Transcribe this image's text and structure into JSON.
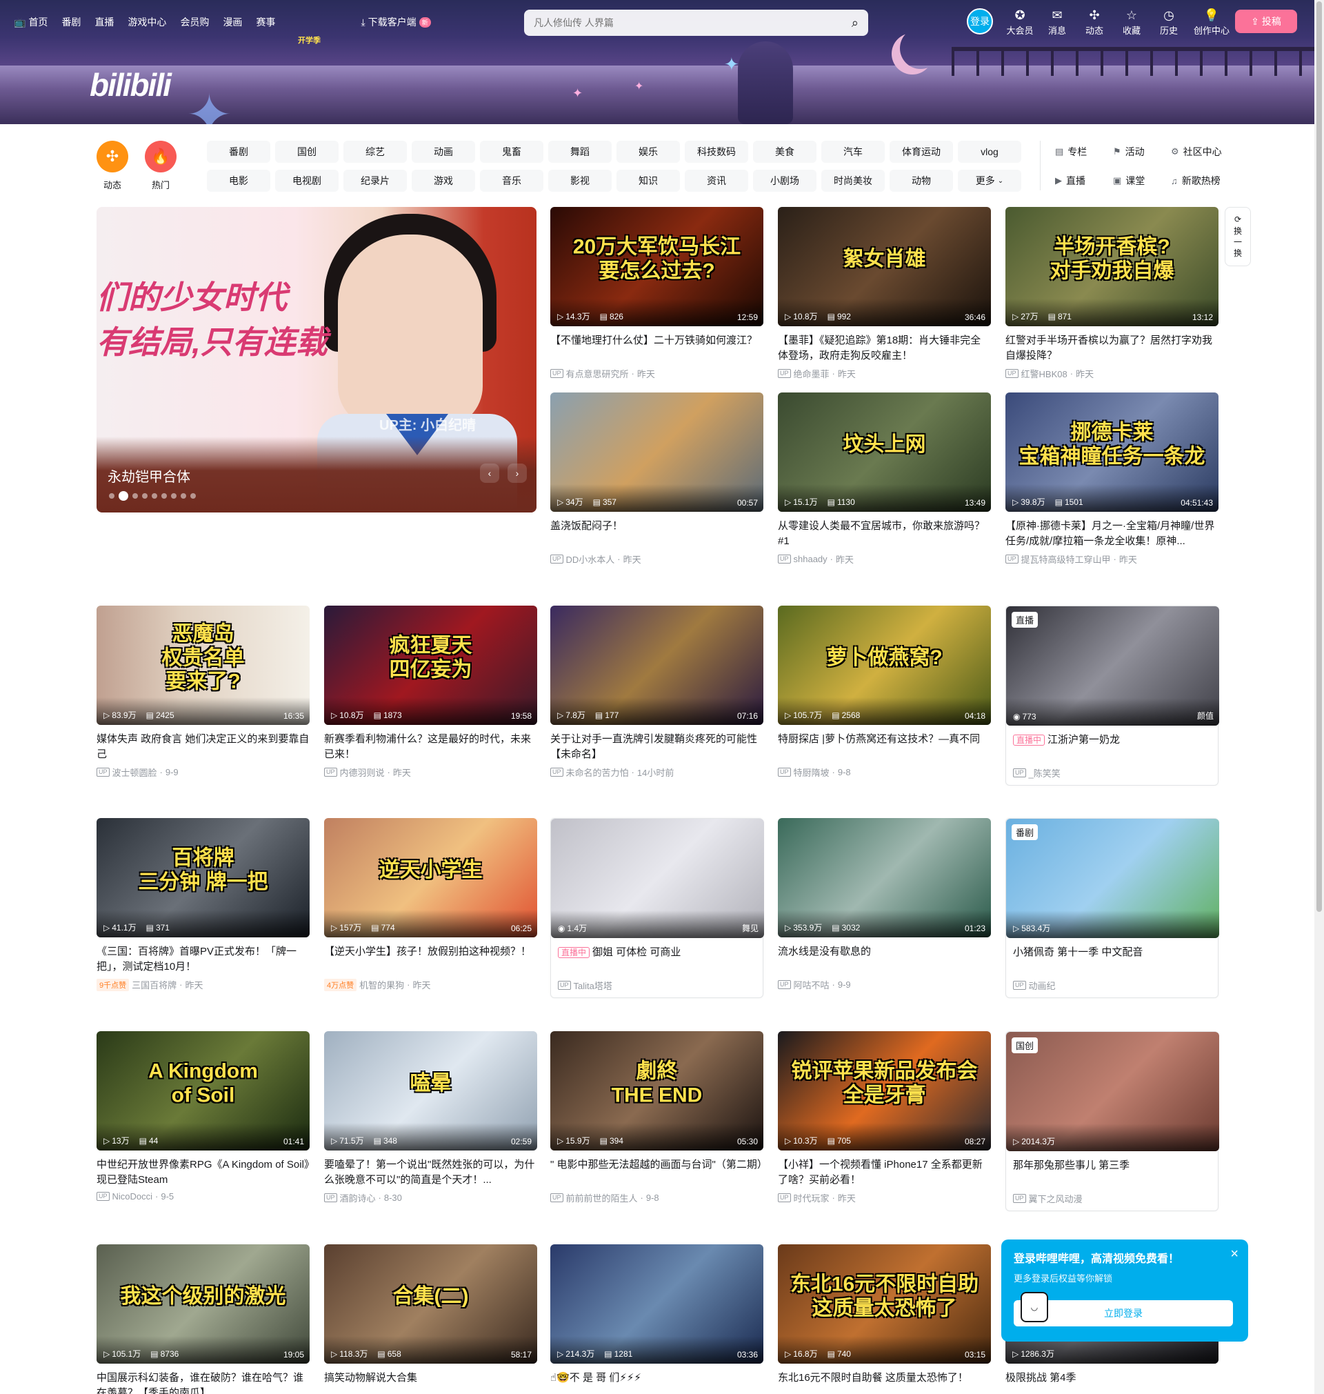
{
  "nav": {
    "left": [
      {
        "icon": "tv-icon",
        "label": "首页"
      },
      {
        "label": "番剧"
      },
      {
        "label": "直播"
      },
      {
        "label": "游戏中心"
      },
      {
        "label": "会员购"
      },
      {
        "label": "漫画"
      },
      {
        "label": "赛事"
      }
    ],
    "download": {
      "label": "下载客户端",
      "badge": "新"
    },
    "search": {
      "placeholder": "凡人修仙传 人界篇"
    },
    "login_avatar": "登录",
    "right": [
      {
        "icon": "vip-icon",
        "label": "大会员"
      },
      {
        "icon": "message-icon",
        "label": "消息"
      },
      {
        "icon": "dynamic-icon",
        "label": "动态"
      },
      {
        "icon": "favorite-icon",
        "label": "收藏"
      },
      {
        "icon": "history-icon",
        "label": "历史"
      },
      {
        "icon": "creator-icon",
        "label": "创作中心"
      }
    ],
    "upload": "投稿"
  },
  "banner": {
    "logo": "bilibili",
    "tag": "开学季"
  },
  "quick": {
    "dynamic": "动态",
    "hot": "热门"
  },
  "channels": [
    "番剧",
    "国创",
    "综艺",
    "动画",
    "鬼畜",
    "舞蹈",
    "娱乐",
    "科技数码",
    "美食",
    "汽车",
    "体育运动",
    "vlog",
    "电影",
    "电视剧",
    "纪录片",
    "游戏",
    "音乐",
    "影视",
    "知识",
    "资讯",
    "小剧场",
    "时尚美妆",
    "动物",
    "更多"
  ],
  "side_links": [
    {
      "icon": "column-icon",
      "label": "专栏"
    },
    {
      "icon": "activity-icon",
      "label": "活动"
    },
    {
      "icon": "community-icon",
      "label": "社区中心"
    },
    {
      "icon": "live-icon",
      "label": "直播"
    },
    {
      "icon": "course-icon",
      "label": "课堂"
    },
    {
      "icon": "music-icon",
      "label": "新歌热榜"
    }
  ],
  "carousel": {
    "title": "永劫铠甲合体",
    "overlay_line1": "们的少女时代",
    "overlay_line2": "有结局,只有连载",
    "up_mark": "UP主: 小白纪晴",
    "dot_count": 9,
    "active_dot": 1
  },
  "refresh": [
    "换",
    "一",
    "换"
  ],
  "cards": [
    {
      "art": "20万大军饮马长江\n要怎么过去?",
      "plays": "14.3万",
      "danmaku": "826",
      "duration": "12:59",
      "title": "【不懂地理打什么仗】二十万铁骑如何渡江？",
      "up": "有点意思研究所",
      "date": "昨天",
      "bg": "linear-gradient(135deg,#2a0a05,#8a2a10 50%,#1a0802)"
    },
    {
      "art": "絮女肖雄",
      "plays": "10.8万",
      "danmaku": "992",
      "duration": "36:46",
      "title": "【墨菲】《疑犯追踪》第18期：肖大锤非完全体登场，政府走狗反咬雇主！",
      "up": "绝命墨菲",
      "date": "昨天",
      "bg": "linear-gradient(135deg,#2a2018,#6a4a30 50%,#1a120c)"
    },
    {
      "art": "半场开香槟?\n对手劝我自爆",
      "plays": "27万",
      "danmaku": "871",
      "duration": "13:12",
      "title": "红警对手半场开香槟以为赢了？居然打字劝我自爆投降？",
      "up": "红警HBK08",
      "date": "昨天",
      "bg": "linear-gradient(135deg,#4a5a30,#8a8a50 50%,#3a4a28)"
    },
    {
      "art": "",
      "plays": "34万",
      "danmaku": "357",
      "duration": "00:57",
      "title": "盖浇饭配闷子！",
      "up": "DD小水本人",
      "date": "昨天",
      "bg": "linear-gradient(135deg,#8aa0b0,#d0a060 50%,#5a6a78)"
    },
    {
      "art": "坟头上网",
      "plays": "15.1万",
      "danmaku": "1130",
      "duration": "13:49",
      "title": "从零建设人类最不宜居城市，你敢来旅游吗？ #1",
      "up": "shhaady",
      "date": "昨天",
      "bg": "linear-gradient(135deg,#3a4a30,#6a7a50 50%,#2a3a22)"
    },
    {
      "art": "挪德卡莱\n宝箱神瞳任务一条龙",
      "plays": "39.8万",
      "danmaku": "1501",
      "duration": "04:51:43",
      "title": "【原神·挪德卡莱】月之一·全宝箱/月神瞳/世界任务/成就/摩拉箱一条龙全收集！原神...",
      "up": "提瓦特高级特工穿山甲",
      "date": "昨天",
      "bg": "linear-gradient(135deg,#3a4a7a,#7a8ab0 50%,#2a3a60)"
    },
    {
      "art": "恶魔岛\n权贵名单\n要来了?",
      "plays": "83.9万",
      "danmaku": "2425",
      "duration": "16:35",
      "title": "媒体失声 政府食言 她们决定正义的来到要靠自己",
      "up": "波士顿圆脸",
      "date": "9-9",
      "bg": "linear-gradient(90deg,#c0a090,#e0d0c0 40%,#f4f0e8)"
    },
    {
      "art": "疯狂夏天\n四亿妄为",
      "plays": "10.8万",
      "danmaku": "1873",
      "duration": "19:58",
      "title": "新赛季看利物浦什么？这是最好的时代，未来已来！",
      "up": "内德羽则说",
      "date": "昨天",
      "bg": "linear-gradient(135deg,#2a1a3a,#a01820 50%,#3a1a2a)"
    },
    {
      "art": "",
      "plays": "7.8万",
      "danmaku": "177",
      "duration": "07:16",
      "title": "关于让对手一直洗牌引发腱鞘炎疼死的可能性【未命名】",
      "up": "未命名的苦力怕",
      "date": "14小时前",
      "bg": "linear-gradient(135deg,#3a2a60,#a07a40 50%,#2a1a40)"
    },
    {
      "art": "萝卜做燕窝?",
      "plays": "105.7万",
      "danmaku": "2568",
      "duration": "04:18",
      "title": "特厨探店 |萝卜仿燕窝还有这技术？—真不同",
      "up": "特厨隋坡",
      "date": "9-8",
      "bg": "linear-gradient(135deg,#5a6a20,#d0b040 50%,#4a5a18)"
    },
    {
      "live": true,
      "tag": "直播",
      "viewers": "773",
      "corner": "颜值",
      "title": "江浙沪第一奶龙",
      "up": "_陈笑笑",
      "bg": "linear-gradient(135deg,#303038,#90909a 50%,#404048)"
    },
    {
      "art": "百将牌\n三分钟 牌一把",
      "plays": "41.1万",
      "danmaku": "371",
      "duration": "",
      "title": "《三国：百将牌》首曝PV正式发布！「牌一把」，测试定档10月！",
      "hot": "9千点赞",
      "up": "三国百将牌",
      "date": "昨天",
      "bg": "linear-gradient(135deg,#2a3038,#6a7078 50%,#1a2028)"
    },
    {
      "art": "逆天小学生",
      "plays": "157万",
      "danmaku": "774",
      "duration": "06:25",
      "title": "【逆天小学生】孩子！放假别拍这种视频？！",
      "hot": "4万点赞",
      "up": "机智的果狗",
      "date": "昨天",
      "bg": "linear-gradient(135deg,#c08060,#f0c080 50%,#e05030)"
    },
    {
      "live": true,
      "tag": "",
      "viewers": "1.4万",
      "corner": "舞见",
      "title": "御姐 可体检 可商业",
      "up": "Talita塔塔",
      "bg": "linear-gradient(135deg,#c0c0c8,#e8e8ee 50%,#b0b0b8)"
    },
    {
      "art": "",
      "plays": "353.9万",
      "danmaku": "3032",
      "duration": "01:23",
      "title": "流水线是没有歇息的",
      "up": "阿咕不咕",
      "date": "9-9",
      "bg": "linear-gradient(135deg,#3a6a5a,#a0b8b0 50%,#2a5a4a)"
    },
    {
      "bangumi": true,
      "tag": "番剧",
      "plays": "583.4万",
      "title": "小猪佩奇 第十一季 中文配音",
      "up": "动画纪",
      "bg": "linear-gradient(135deg,#6ab0e0,#a0d0f0 50%,#60b060)"
    },
    {
      "art": "A Kingdom\nof Soil",
      "plays": "13万",
      "danmaku": "44",
      "duration": "01:41",
      "title": "中世纪开放世界像素RPG《A Kingdom of Soil》现已登陆Steam",
      "up": "NicoDocci",
      "date": "9-5",
      "bg": "linear-gradient(135deg,#2a3a18,#6a7a38 50%,#1a2a10)"
    },
    {
      "art": "嗑晕",
      "plays": "71.5万",
      "danmaku": "348",
      "duration": "02:59",
      "title": "要嗑晕了！第一个说出\"既然姓张的可以，为什么张晚意不可以\"的简直是个天才！...",
      "up": "酒韵诗心",
      "date": "8-30",
      "bg": "linear-gradient(135deg,#a0b0c0,#e0e8f0 50%,#90a0b0)"
    },
    {
      "art": "劇終\nTHE END",
      "plays": "15.9万",
      "danmaku": "394",
      "duration": "05:30",
      "title": "\" 电影中那些无法超越的画面与台词\"（第二期）",
      "up": "前前前世的陌生人",
      "date": "9-8",
      "bg": "linear-gradient(135deg,#3a2a20,#8a6a50 50%,#1a1210)"
    },
    {
      "art": "锐评苹果新品发布会\n全是牙膏",
      "plays": "10.3万",
      "danmaku": "705",
      "duration": "08:27",
      "title": "【小祥】一个视频看懂 iPhone17 全系都更新了啥？买前必看！",
      "up": "时代玩家",
      "date": "昨天",
      "bg": "linear-gradient(135deg,#1a1a1e,#e06a20 50%,#2a2a30)"
    },
    {
      "bangumi": true,
      "tag": "国创",
      "plays": "2014.3万",
      "title": "那年那兔那些事儿 第三季",
      "up": "翼下之风动漫",
      "bg": "linear-gradient(135deg,#8a5a50,#c08070 50%,#6a3a30)"
    },
    {
      "art": "我这个级别的激光",
      "plays": "105.1万",
      "danmaku": "8736",
      "duration": "19:05",
      "title": "中国展示科幻装备，谁在破防？谁在哈气？谁在羡慕？【季手的南瓜】",
      "up": "",
      "date": "",
      "bg": "linear-gradient(135deg,#5a6050,#a0a890 50%,#40483a)"
    },
    {
      "art": "合集(二)",
      "plays": "118.3万",
      "danmaku": "658",
      "duration": "58:17",
      "title": "搞笑动物解说大合集",
      "up": "",
      "date": "",
      "bg": "linear-gradient(135deg,#5a4030,#a08060 50%,#3a2a20)"
    },
    {
      "art": "",
      "plays": "214.3万",
      "danmaku": "1281",
      "duration": "03:36",
      "title": "☝🤓不 是 哥 们⚡⚡⚡",
      "up": "",
      "date": "",
      "bg": "linear-gradient(135deg,#2a3a6a,#6a8ab0 50%,#1a2a50)"
    },
    {
      "art": "东北16元不限时自助\n这质量太恐怖了",
      "plays": "16.8万",
      "danmaku": "740",
      "duration": "03:15",
      "title": "东北16元不限时自助餐 这质量太恐怖了！",
      "up": "",
      "date": "",
      "bg": "linear-gradient(135deg,#6a3a1a,#c07030 50%,#4a2a10)"
    },
    {
      "art": "",
      "plays": "1286.3万",
      "danmaku": "",
      "duration": "",
      "title": "极限挑战 第4季",
      "up": "",
      "date": "",
      "bg": "linear-gradient(135deg,#2a2a30,#6a6a70 50%,#1a1a20)"
    }
  ],
  "popup": {
    "title": "登录哔哩哔哩，高清视频免费看！",
    "subtitle": "更多登录后权益等你解锁",
    "button": "立即登录",
    "close": "×"
  }
}
